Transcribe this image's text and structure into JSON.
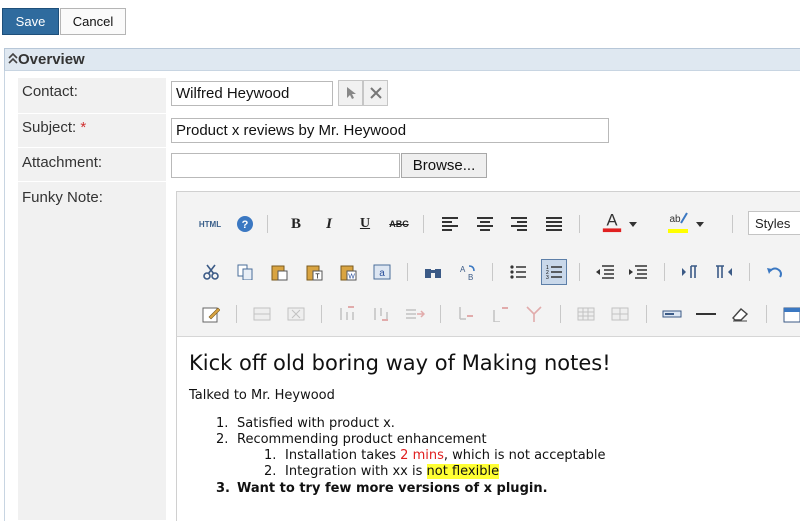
{
  "toolbar": {
    "save_label": "Save",
    "cancel_label": "Cancel"
  },
  "section": {
    "title": "Overview"
  },
  "form": {
    "contact": {
      "label": "Contact:",
      "value": "Wilfred Heywood"
    },
    "subject": {
      "label": "Subject:",
      "required_mark": "*",
      "value": "Product x reviews by Mr. Heywood"
    },
    "attachment": {
      "label": "Attachment:",
      "value": "",
      "browse_label": "Browse..."
    },
    "note": {
      "label": "Funky Note:"
    }
  },
  "editor": {
    "html_button": "HTML",
    "styles_placeholder": "Styles",
    "colors": {
      "font_color": "#e02020",
      "highlight_color": "#ffff00",
      "accent": "#2f6b9e"
    },
    "content": {
      "heading": "Kick off old boring way of Making notes!",
      "intro": "Talked to Mr. Heywood",
      "items": [
        {
          "num": "1.",
          "text": "Satisfied with product x."
        },
        {
          "num": "2.",
          "text": "Recommending product enhancement"
        }
      ],
      "subitems": [
        {
          "num": "1.",
          "pre": "Installation takes ",
          "red": "2 mins",
          "post": ", which is not acceptable"
        },
        {
          "num": "2.",
          "pre": "Integration with xx is ",
          "highlight": "not flexible"
        }
      ],
      "item3": {
        "num": "3.",
        "text": "Want to try few more versions of x plugin."
      }
    }
  }
}
